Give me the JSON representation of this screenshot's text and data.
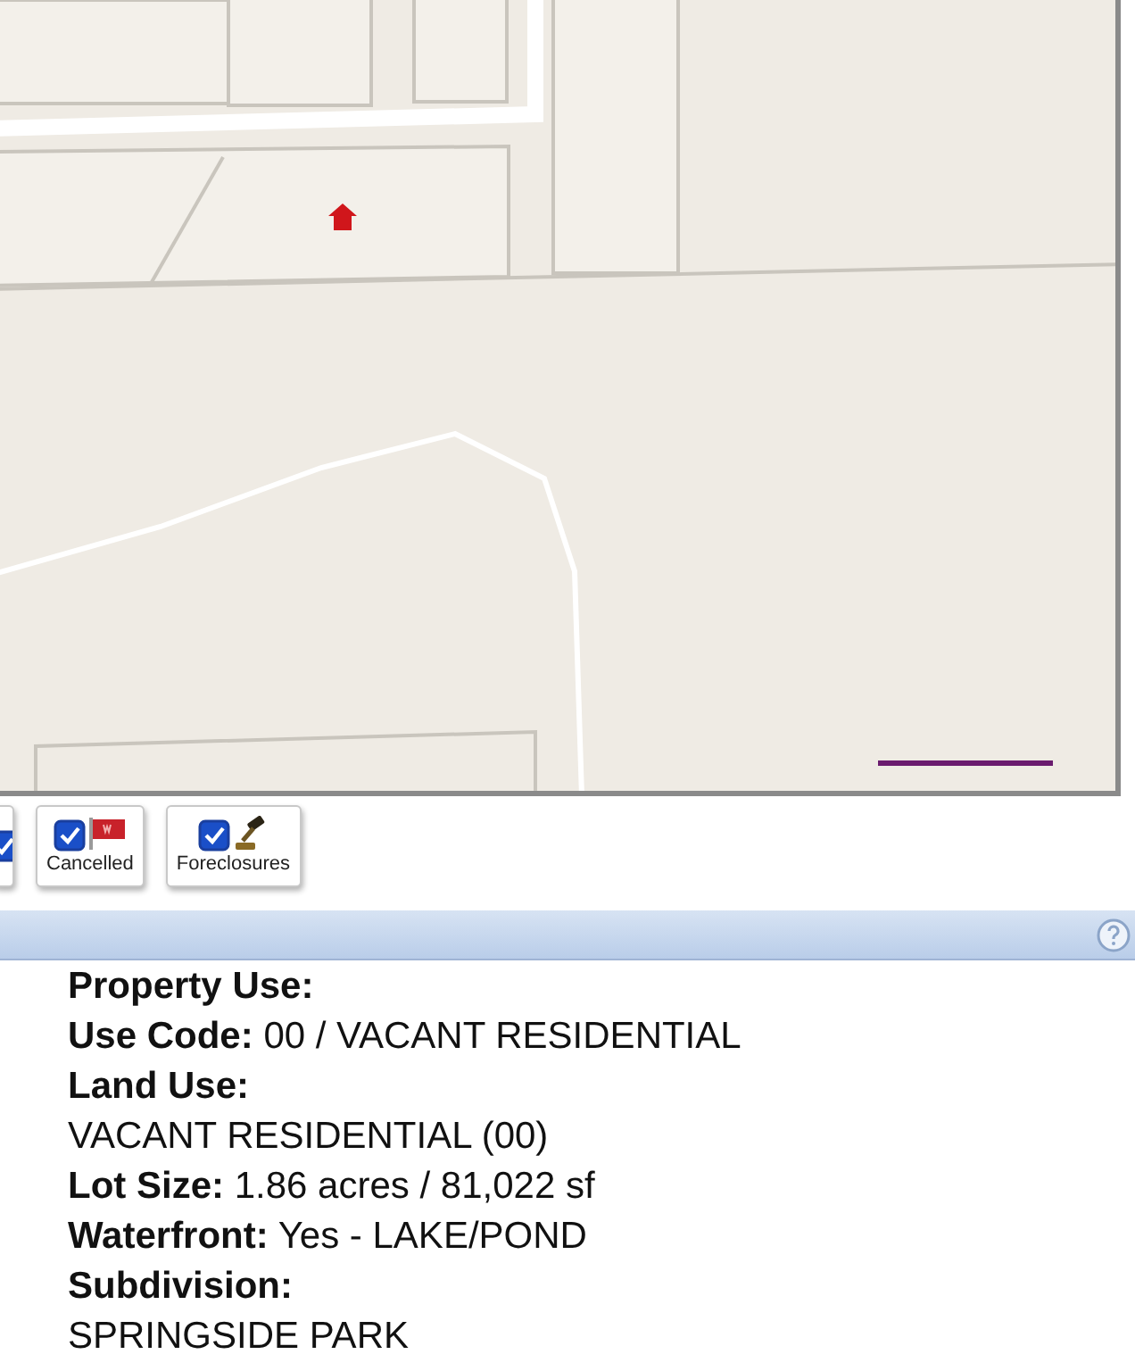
{
  "filters": [
    {
      "checked": true
    },
    {
      "label": "Cancelled",
      "checked": true,
      "kind": "flag"
    },
    {
      "label": "Foreclosures",
      "checked": true,
      "kind": "gavel"
    }
  ],
  "details": [
    {
      "kind": "heading",
      "text": "Property Use:"
    },
    {
      "kind": "text",
      "text": "**Use Code:** 00 / VACANT RESIDENTIAL"
    },
    {
      "kind": "heading",
      "text": "Land Use:"
    },
    {
      "kind": "text",
      "text": "VACANT RESIDENTIAL (00)"
    },
    {
      "kind": "text",
      "text": "**Lot Size:** 1.86 acres / 81,022 sf"
    },
    {
      "kind": "text",
      "text": "**Waterfront:** Yes - LAKE/POND"
    },
    {
      "kind": "heading",
      "text": "Subdivision:"
    },
    {
      "kind": "text",
      "text": "SPRINGSIDE PARK"
    }
  ]
}
